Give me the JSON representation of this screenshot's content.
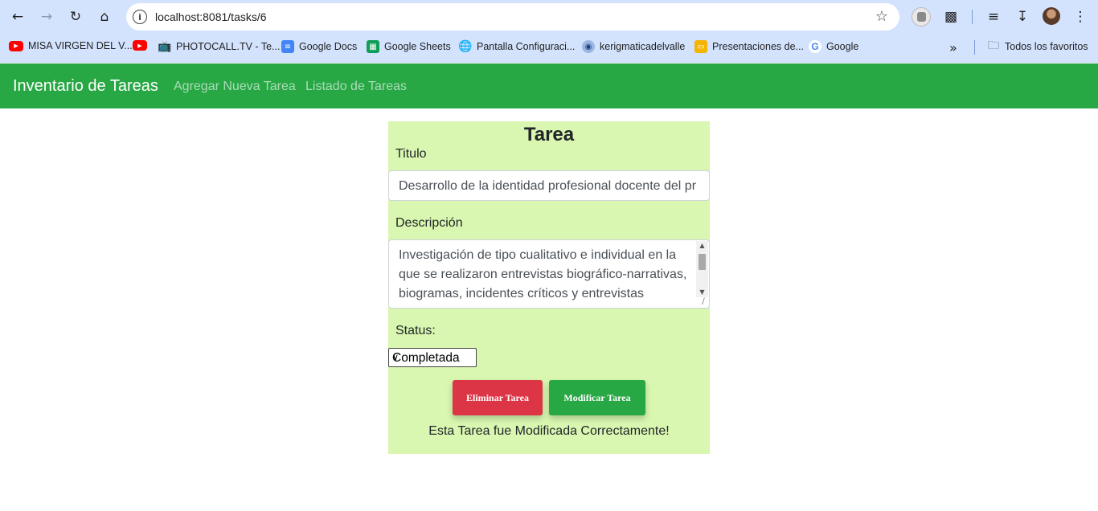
{
  "browser": {
    "url": "localhost:8081/tasks/6",
    "bookmarks": [
      {
        "label": "MISA VIRGEN DEL V...",
        "icon": "youtube-icon"
      },
      {
        "label": "",
        "icon": "youtube-icon"
      },
      {
        "label": "PHOTOCALL.TV - Te...",
        "icon": "tv-icon"
      },
      {
        "label": "Google Docs",
        "icon": "docs-icon"
      },
      {
        "label": "Google Sheets",
        "icon": "sheets-icon"
      },
      {
        "label": "Pantalla Configuraci...",
        "icon": "globe-icon"
      },
      {
        "label": "kerigmaticadelvalle",
        "icon": "site-icon"
      },
      {
        "label": "Presentaciones de...",
        "icon": "slides-icon"
      },
      {
        "label": "Google",
        "icon": "google-icon"
      }
    ],
    "all_bookmarks_label": "Todos los favoritos"
  },
  "navbar": {
    "brand": "Inventario de Tareas",
    "links": [
      "Agregar Nueva Tarea",
      "Listado de Tareas"
    ],
    "color": "#28a745"
  },
  "form": {
    "title": "Tarea",
    "title_label": "Titulo",
    "title_value": "Desarrollo de la identidad profesional docente del pr",
    "description_label": "Descripción",
    "description_value": "Investigación de tipo cualitativo e individual en la que se realizaron entrevistas biográfico-narrativas, biogramas, incidentes críticos y entrevistas",
    "status_label": "Status:",
    "status_value": "Completada",
    "delete_button": "Eliminar Tarea",
    "update_button": "Modificar Tarea",
    "message": "Esta Tarea fue Modificada Correctamente!",
    "card_color": "#d9f7b0"
  }
}
